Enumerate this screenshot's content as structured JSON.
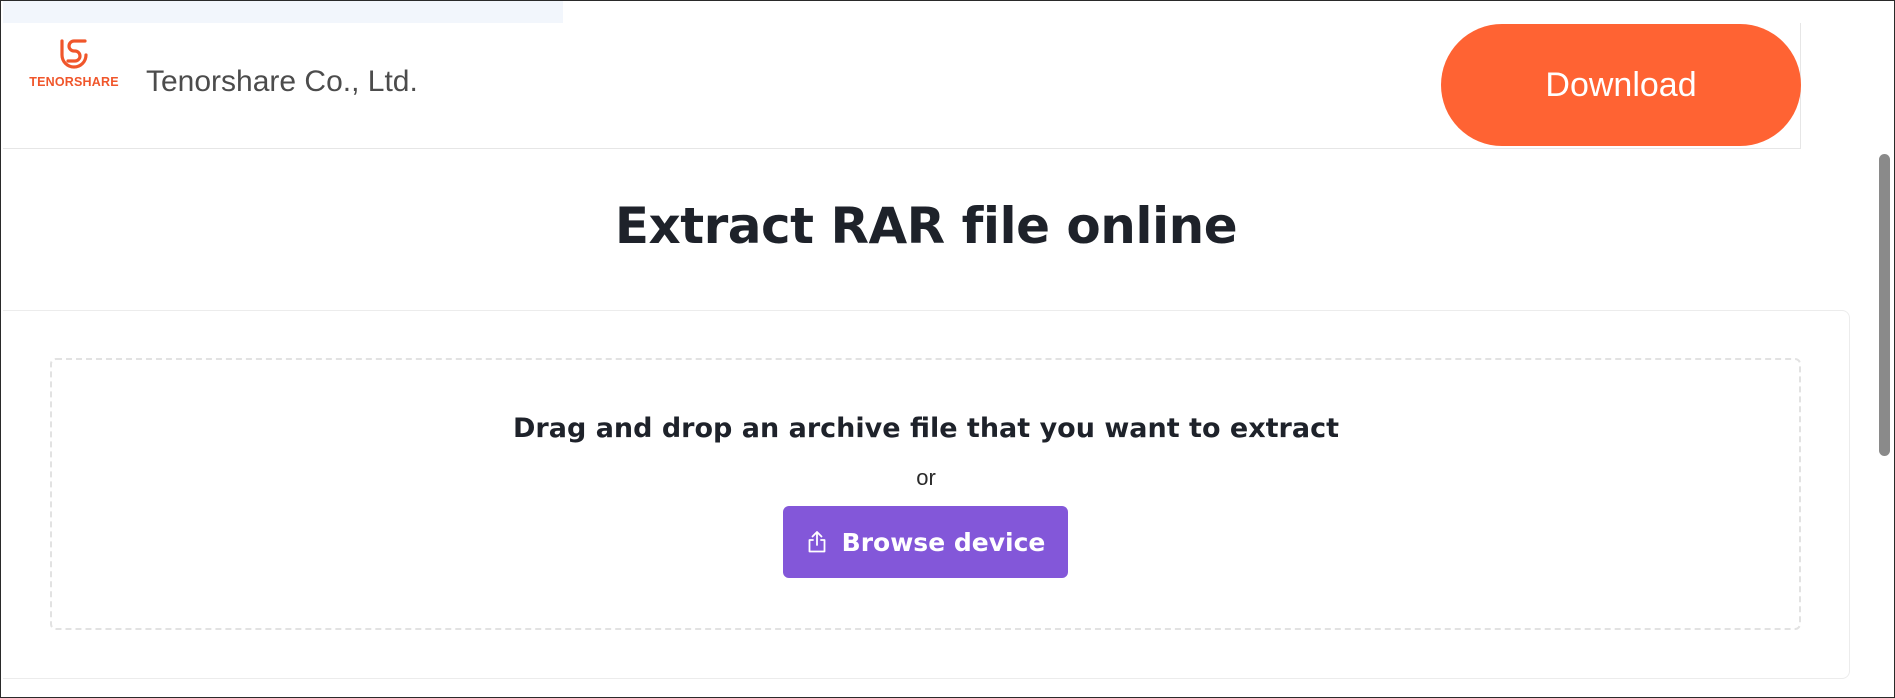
{
  "ad_banner": {
    "brand_logo_text": "TENORSHARE",
    "company_name": "Tenorshare Co., Ltd.",
    "download_label": "Download"
  },
  "main": {
    "title": "Extract RAR file online",
    "drop_text": "Drag and drop an archive file that you want to extract",
    "or_text": "or",
    "browse_label": "Browse device",
    "browse_icon": "upload-icon"
  },
  "colors": {
    "brand_orange": "#ff6333",
    "browse_purple": "#8357d9",
    "title_text": "#1e222a"
  }
}
